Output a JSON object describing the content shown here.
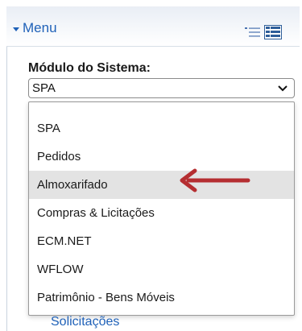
{
  "menu": {
    "toggle_label": "Menu",
    "list_view_icon": "list-view-icon",
    "detail_view_icon": "detail-view-icon"
  },
  "module": {
    "label": "Módulo do Sistema:",
    "selected_value": "SPA",
    "options": [
      "SPA",
      "Pedidos",
      "Almoxarifado",
      "Compras & Licitações",
      "ECM.NET",
      "WFLOW",
      "Patrimônio - Bens Móveis"
    ],
    "highlighted_option": "Almoxarifado"
  },
  "annotation": {
    "arrow_icon": "red-pointer-arrow",
    "arrow_color": "#b52e31"
  },
  "links": {
    "partial_item": "Solicitações"
  },
  "colors": {
    "link_blue": "#1f61b8",
    "highlight": "#e3e3e3"
  }
}
